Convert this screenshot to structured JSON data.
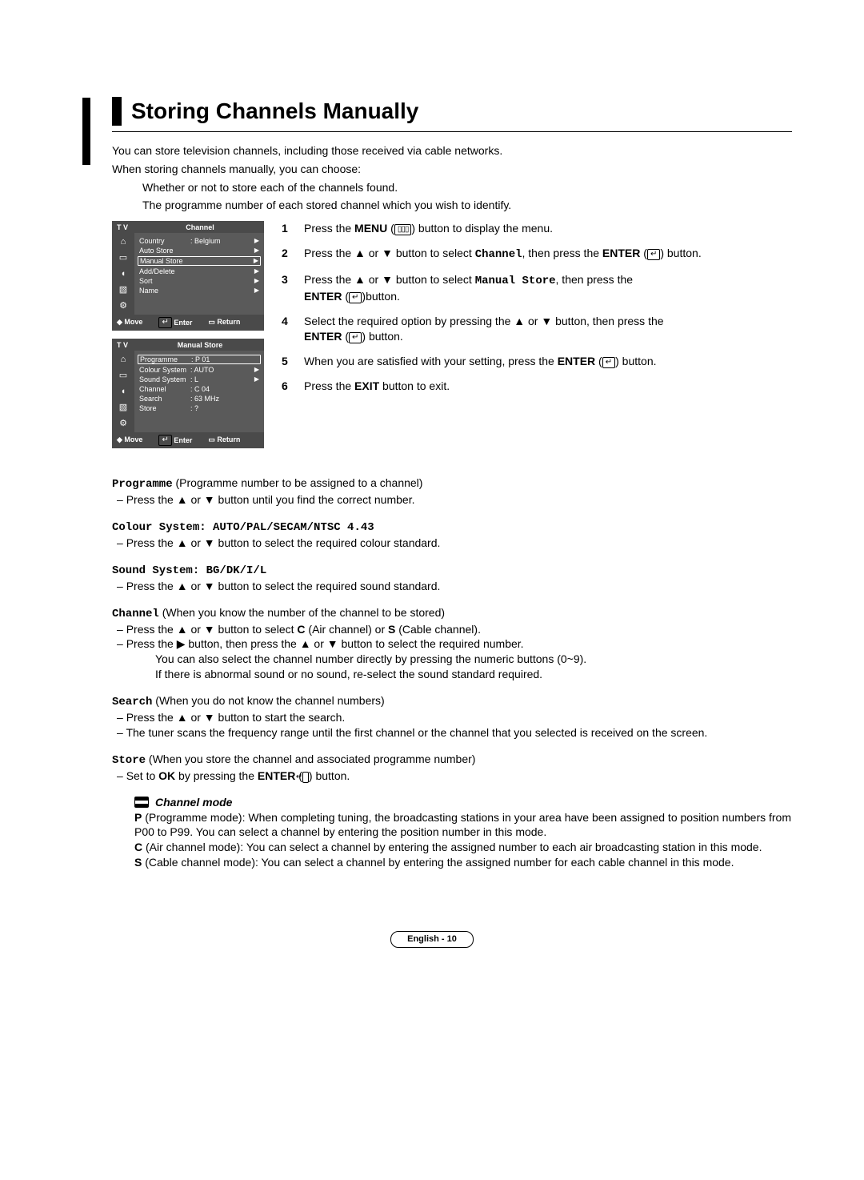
{
  "title": "Storing Channels Manually",
  "intro_lines": [
    "You can store television channels, including those received via cable networks.",
    "When storing channels manually, you can choose:"
  ],
  "intro_sub": [
    "Whether or not to store each of the channels found.",
    "The programme number of each stored channel which you wish to identify."
  ],
  "osd1": {
    "title_left": "T V",
    "title_center": "Channel",
    "rows": [
      {
        "label": "Country",
        "value": ": Belgium",
        "arrow": true,
        "hl": false
      },
      {
        "label": "Auto Store",
        "value": "",
        "arrow": true,
        "hl": false
      },
      {
        "label": "Manual Store",
        "value": "",
        "arrow": true,
        "hl": true
      },
      {
        "label": "Add/Delete",
        "value": "",
        "arrow": true,
        "hl": false
      },
      {
        "label": "Sort",
        "value": "",
        "arrow": true,
        "hl": false
      },
      {
        "label": "Name",
        "value": "",
        "arrow": true,
        "hl": false
      }
    ],
    "foot": {
      "move": "Move",
      "enter": "Enter",
      "ret": "Return"
    }
  },
  "osd2": {
    "title_left": "T V",
    "title_center": "Manual Store",
    "rows": [
      {
        "label": "Programme",
        "value": ": P  01",
        "arrow": false,
        "hl": true
      },
      {
        "label": "Colour System",
        "value": ": AUTO",
        "arrow": true,
        "hl": false
      },
      {
        "label": "Sound System",
        "value": ": L",
        "arrow": true,
        "hl": false
      },
      {
        "label": "Channel",
        "value": ": C 04",
        "arrow": false,
        "hl": false
      },
      {
        "label": "Search",
        "value": ":    63   MHz",
        "arrow": false,
        "hl": false
      },
      {
        "label": "Store",
        "value": ": ?",
        "arrow": false,
        "hl": false
      }
    ],
    "foot": {
      "move": "Move",
      "enter": "Enter",
      "ret": "Return"
    }
  },
  "steps": {
    "s1": {
      "n": "1",
      "a": "Press the ",
      "b": "MENU",
      "c": " button to display the menu."
    },
    "s2": {
      "n": "2",
      "a": "Press the ▲ or ▼ button to select ",
      "b": "Channel",
      "c": ", then press the ",
      "d": "ENTER",
      "e": " button."
    },
    "s3": {
      "n": "3",
      "a": "Press the ▲ or ▼ button to select ",
      "b": "Manual Store",
      "c": ", then press the ",
      "d": "ENTER",
      "e": "button."
    },
    "s4": {
      "n": "4",
      "a": "Select the required option by pressing the ▲ or ▼ button, then press the ",
      "b": "ENTER",
      "c": " button."
    },
    "s5": {
      "n": "5",
      "a": "When you are satisfied with your setting, press the ",
      "b": "ENTER",
      "c": " button."
    },
    "s6": {
      "n": "6",
      "a": "Press the ",
      "b": "EXIT",
      "c": " button to exit."
    }
  },
  "def_programme": {
    "head": "Programme",
    "head_after": " (Programme number to be assigned to a channel)",
    "line": "Press the ▲ or ▼ button until you find the correct number."
  },
  "def_colour": {
    "head": "Colour System: AUTO/PAL/SECAM/NTSC 4.43",
    "line": "Press the ▲ or ▼ button to select the required colour standard."
  },
  "def_sound": {
    "head": "Sound System: BG/DK/I/L",
    "line": "Press the ▲ or ▼ button to select the required sound standard."
  },
  "def_channel": {
    "head": "Channel",
    "head_after": " (When you know the number of the channel to be stored)",
    "l1a": "Press the ▲ or ▼ button to select ",
    "l1b": "C",
    "l1c": " (Air channel) or ",
    "l1d": "S",
    "l1e": " (Cable channel).",
    "l2": "Press the ▶ button, then press the ▲ or ▼ button to select the required number.",
    "l3": "You can also select the channel number directly by pressing the numeric buttons (0~9).",
    "l4": "If there is abnormal sound or no sound, re-select the sound standard required."
  },
  "def_search": {
    "head": "Search",
    "head_after": " (When you do not know the channel numbers)",
    "l1": "Press the ▲ or ▼ button to start the search.",
    "l2": "The tuner scans the frequency range until the first channel or the channel that you selected is received on the screen."
  },
  "def_store": {
    "head": "Store",
    "head_after": " (When you store the channel and associated programme number)",
    "l1a": "Set to ",
    "l1b": "OK",
    "l1c": " by pressing the ",
    "l1d": "ENTER",
    "l1e": " button."
  },
  "chmode": {
    "title": "Channel mode",
    "p1a": "P",
    "p1b": " (Programme mode): When completing tuning, the broadcasting stations in your area have been assigned to position numbers from P00 to P99. You can select a channel by entering the position number in this mode.",
    "p2a": "C",
    "p2b": " (Air channel mode): You can select a channel by entering the assigned number to each air broadcasting station in this mode.",
    "p3a": "S",
    "p3b": " (Cable channel mode): You can select a channel by entering the assigned number for each cable channel in this mode."
  },
  "footer": "English - 10",
  "icons": {
    "enter": "↵",
    "menu": "▯▯▯",
    "up": "▲",
    "down": "▼"
  }
}
